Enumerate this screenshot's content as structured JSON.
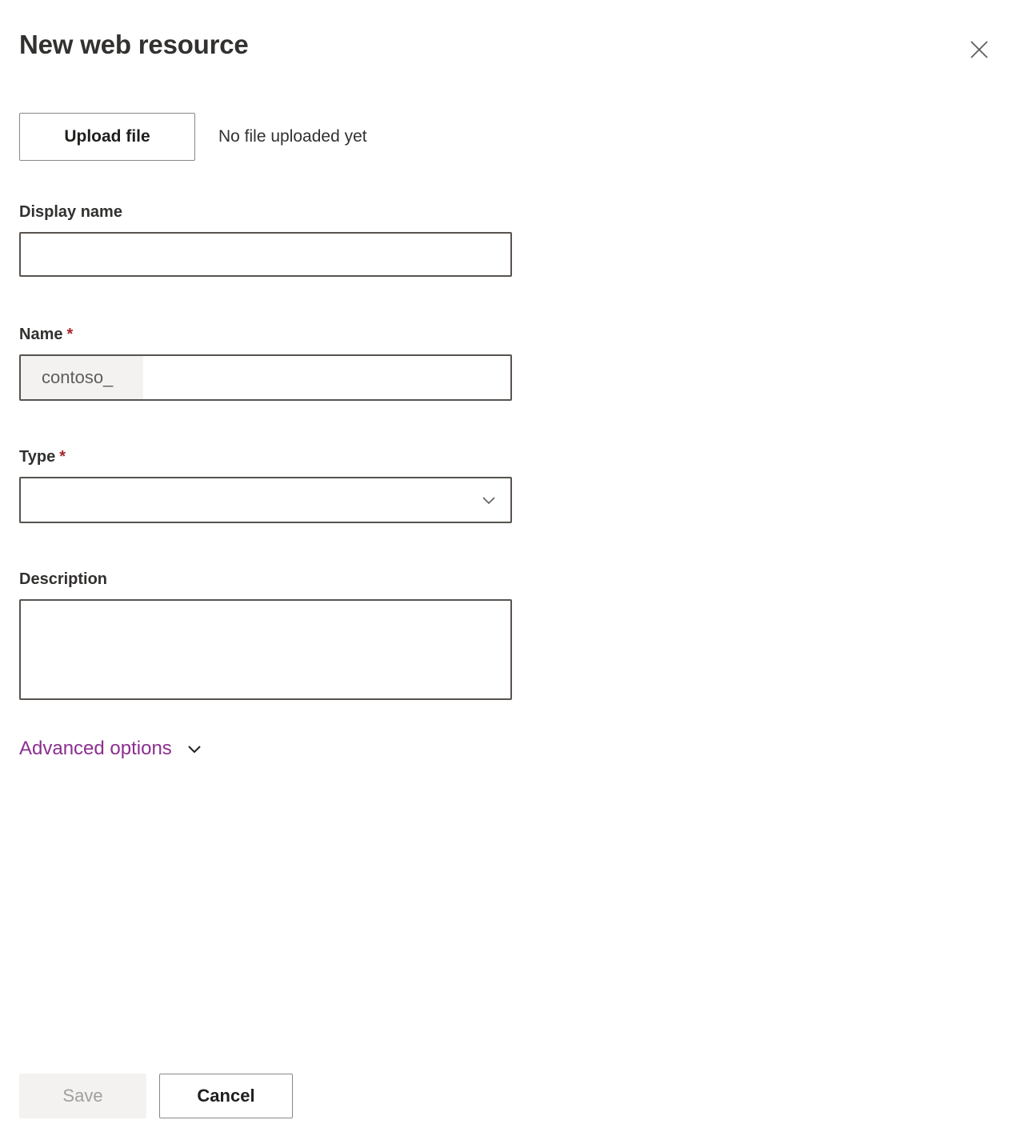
{
  "panel": {
    "title": "New web resource",
    "close_icon": "close-icon"
  },
  "upload": {
    "button_label": "Upload file",
    "status_text": "No file uploaded yet"
  },
  "fields": {
    "display_name": {
      "label": "Display name",
      "value": "",
      "placeholder": ""
    },
    "name": {
      "label": "Name",
      "required_marker": "*",
      "prefix": "contoso_",
      "value": "",
      "placeholder": ""
    },
    "type": {
      "label": "Type",
      "required_marker": "*",
      "value": "",
      "caret_icon": "chevron-down-icon"
    },
    "description": {
      "label": "Description",
      "value": "",
      "placeholder": ""
    }
  },
  "advanced": {
    "label": "Advanced options",
    "caret_icon": "chevron-down-icon"
  },
  "footer": {
    "save_label": "Save",
    "cancel_label": "Cancel"
  },
  "colors": {
    "accent_purple": "#8b2f8f",
    "required_red": "#a4262c",
    "input_border": "#57534f",
    "button_border": "#8a8886",
    "disabled_bg": "#f3f2f1",
    "disabled_text": "#a19f9d",
    "prefix_bg": "#f3f2f1",
    "text_primary": "#323130"
  }
}
